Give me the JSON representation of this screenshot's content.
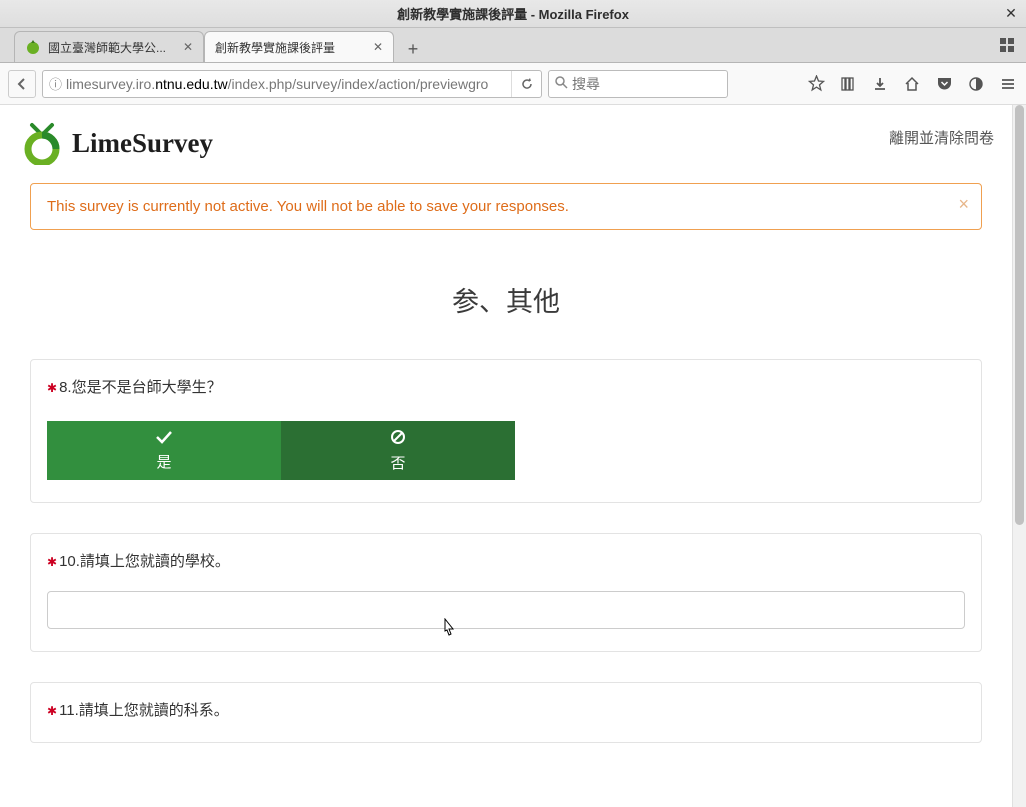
{
  "window": {
    "title": "創新教學實施課後評量 - Mozilla Firefox"
  },
  "tabs": {
    "bg_label": "國立臺灣師範大學公...",
    "active_label": "創新教學實施課後評量"
  },
  "address_bar": {
    "url_display": "limesurvey.iro.ntnu.edu.tw/index.php/survey/index/action/previewgro",
    "url_bold_host": "ntnu.edu.tw"
  },
  "search": {
    "placeholder": "搜尋"
  },
  "header": {
    "brand": "LimeSurvey",
    "exit_link": "離開並清除問卷"
  },
  "alert": {
    "text": "This survey is currently not active. You will not be able to save your responses."
  },
  "section": {
    "title": "参、其他"
  },
  "q8": {
    "text": "8.您是不是台師大學生？",
    "yes_label": "是",
    "no_label": "否"
  },
  "q10": {
    "text": "10.請填上您就讀的學校。",
    "value": ""
  },
  "q11": {
    "text": "11.請填上您就讀的科系。"
  }
}
